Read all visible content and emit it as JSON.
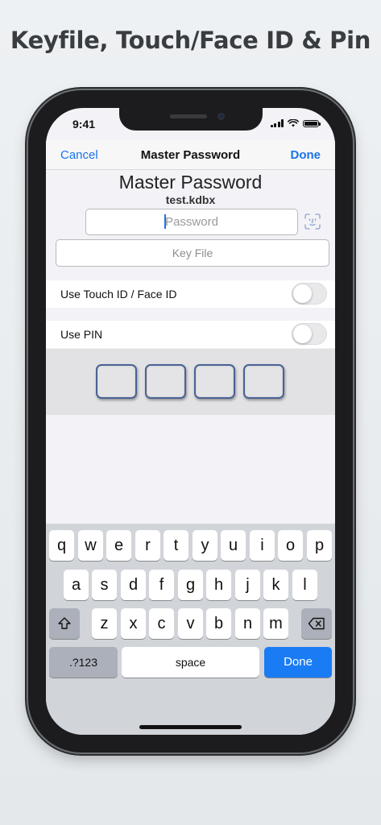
{
  "headline": "Keyfile, Touch/Face ID & Pin",
  "status_bar": {
    "time": "9:41"
  },
  "nav": {
    "cancel": "Cancel",
    "title": "Master Password",
    "done": "Done"
  },
  "master_password": {
    "title": "Master Password",
    "filename": "test.kdbx",
    "password_placeholder": "Password",
    "password_value": "",
    "key_file_label": "Key File"
  },
  "options": {
    "touch_id_label": "Use Touch ID / Face ID",
    "touch_id_enabled": false,
    "pin_label": "Use PIN",
    "pin_enabled": false
  },
  "pin": {
    "digit_count": 4,
    "digits": [
      "",
      "",
      "",
      ""
    ]
  },
  "keyboard": {
    "row1": [
      "q",
      "w",
      "e",
      "r",
      "t",
      "y",
      "u",
      "i",
      "o",
      "p"
    ],
    "row2": [
      "a",
      "s",
      "d",
      "f",
      "g",
      "h",
      "j",
      "k",
      "l"
    ],
    "row3": [
      "z",
      "x",
      "c",
      "v",
      "b",
      "n",
      "m"
    ],
    "numbers_label": ".?123",
    "space_label": "space",
    "done_label": "Done"
  },
  "colors": {
    "accent": "#1a73e8",
    "pin_border": "#4a6294",
    "keyboard_done": "#1a7cf5"
  }
}
